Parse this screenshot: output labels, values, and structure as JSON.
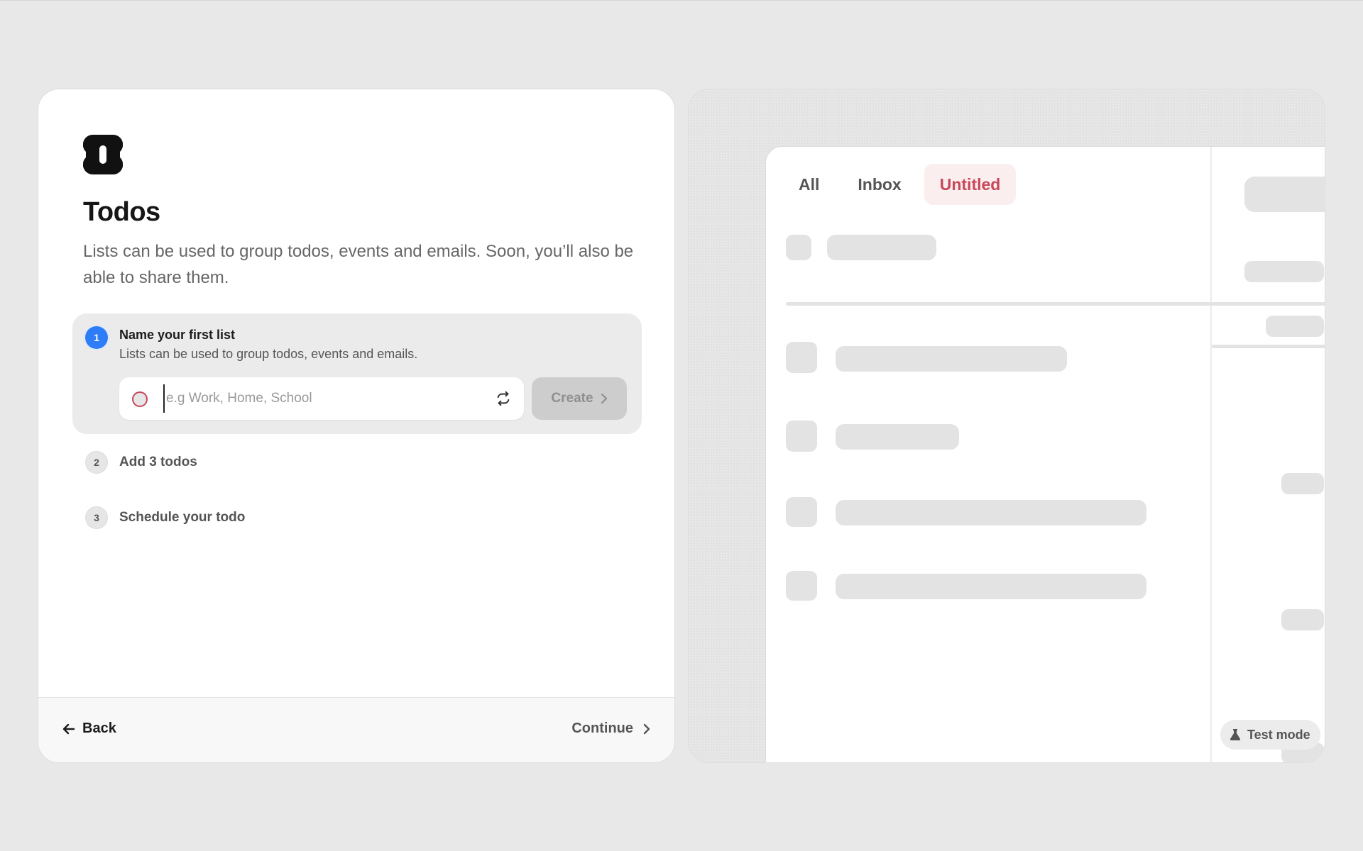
{
  "onboarding": {
    "title": "Todos",
    "subtitle": "Lists can be used to group todos, events and emails. Soon, you’ll also be able to share them.",
    "steps": [
      {
        "number": "1",
        "title": "Name your first list",
        "description": "Lists can be used to group todos, events and emails.",
        "input_placeholder": "e.g Work, Home, School",
        "input_value": "",
        "create_label": "Create"
      },
      {
        "number": "2",
        "title": "Add 3 todos"
      },
      {
        "number": "3",
        "title": "Schedule your todo"
      }
    ],
    "footer": {
      "back_label": "Back",
      "continue_label": "Continue"
    }
  },
  "preview": {
    "tabs": [
      {
        "label": "All",
        "active": false
      },
      {
        "label": "Inbox",
        "active": false
      },
      {
        "label": "Untitled",
        "active": true
      }
    ],
    "badge_label": "Test mode"
  },
  "colors": {
    "accent_blue": "#2e7cf6",
    "list_red": "#c8475a",
    "active_tab_bg": "#fbeeee"
  },
  "icons": [
    "app-logo-icon",
    "shuffle-icon",
    "chevron-right-icon",
    "arrow-left-icon",
    "flask-icon"
  ]
}
